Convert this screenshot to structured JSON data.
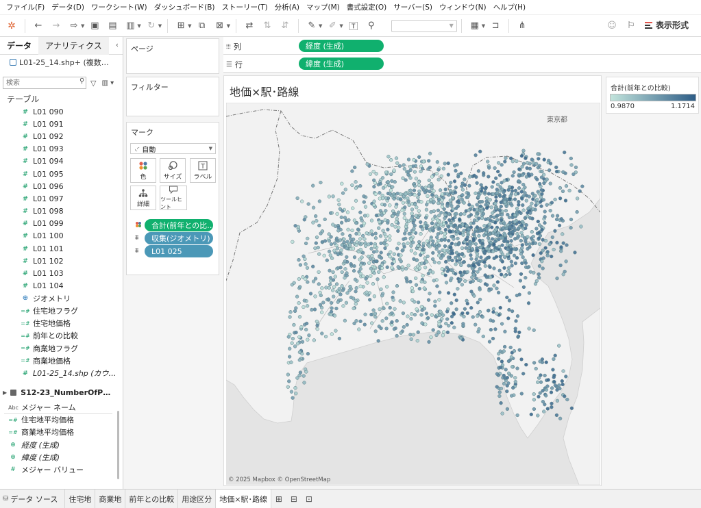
{
  "menu": [
    "ファイル(F)",
    "データ(D)",
    "ワークシート(W)",
    "ダッシュボード(B)",
    "ストーリー(T)",
    "分析(A)",
    "マップ(M)",
    "書式設定(O)",
    "サーバー(S)",
    "ウィンドウ(N)",
    "ヘルプ(H)"
  ],
  "toolbar": {
    "show_format_label": "表示形式"
  },
  "data_pane": {
    "tabs": [
      "データ",
      "アナリティクス"
    ],
    "datasource": "L01-25_14.shp+ (複数…",
    "search_placeholder": "検索",
    "table_heading": "テーブル",
    "fields": [
      {
        "icon": "#",
        "label": "L01 090"
      },
      {
        "icon": "#",
        "label": "L01 091"
      },
      {
        "icon": "#",
        "label": "L01 092"
      },
      {
        "icon": "#",
        "label": "L01 093"
      },
      {
        "icon": "#",
        "label": "L01 094"
      },
      {
        "icon": "#",
        "label": "L01 095"
      },
      {
        "icon": "#",
        "label": "L01 096"
      },
      {
        "icon": "#",
        "label": "L01 097"
      },
      {
        "icon": "#",
        "label": "L01 098"
      },
      {
        "icon": "#",
        "label": "L01 099"
      },
      {
        "icon": "#",
        "label": "L01 100"
      },
      {
        "icon": "#",
        "label": "L01 101"
      },
      {
        "icon": "#",
        "label": "L01 102"
      },
      {
        "icon": "#",
        "label": "L01 103"
      },
      {
        "icon": "#",
        "label": "L01 104"
      },
      {
        "icon": "globe",
        "label": "ジオメトリ"
      },
      {
        "icon": "=#",
        "label": "住宅地フラグ"
      },
      {
        "icon": "=#",
        "label": "住宅地価格"
      },
      {
        "icon": "=#",
        "label": "前年との比較"
      },
      {
        "icon": "=#",
        "label": "商業地フラグ"
      },
      {
        "icon": "=#",
        "label": "商業地価格"
      },
      {
        "icon": "#",
        "label": "L01-25_14.shp (カウ…",
        "italic": true
      }
    ],
    "second_source": "S12-23_NumberOfP…",
    "measures": [
      {
        "icon": "Abc",
        "label": "メジャー ネーム"
      },
      {
        "icon": "=#",
        "label": "住宅地平均価格"
      },
      {
        "icon": "=#",
        "label": "商業地平均価格"
      },
      {
        "icon": "globe",
        "label": "経度 (生成)",
        "italic": true
      },
      {
        "icon": "globe",
        "label": "緯度 (生成)",
        "italic": true
      },
      {
        "icon": "#",
        "label": "メジャー バリュー"
      }
    ]
  },
  "cards": {
    "pages": "ページ",
    "filters": "フィルター",
    "marks": "マーク",
    "mark_type": "自動",
    "buttons": [
      "色",
      "サイズ",
      "ラベル",
      "詳細",
      "ツールヒント"
    ],
    "mark_pills": [
      "合計(前年との比…",
      "収集(ジオメトリ)",
      "L01 025"
    ]
  },
  "shelves": {
    "columns_label": "列",
    "columns_pill": "経度 (生成)",
    "rows_label": "行",
    "rows_pill": "緯度 (生成)"
  },
  "view": {
    "title": "地価×駅･路線",
    "map_label": "東京都",
    "attribution": "© 2025 Mapbox © OpenStreetMap"
  },
  "legend": {
    "title": "合計(前年との比較)",
    "min": "0.9870",
    "max": "1.1714",
    "color_low": "#c2e4dc",
    "color_high": "#2e5d87"
  },
  "tabs": {
    "datasource": "データ ソース",
    "sheets": [
      "住宅地",
      "商業地",
      "前年との比較",
      "用途区分",
      "地価×駅･路線"
    ],
    "active": "地価×駅･路線"
  },
  "colors": {
    "pill_green": "#10b06e",
    "pill_blue": "#4b98b7",
    "land": "#f2f2f2",
    "sea": "#e4e4e4"
  }
}
